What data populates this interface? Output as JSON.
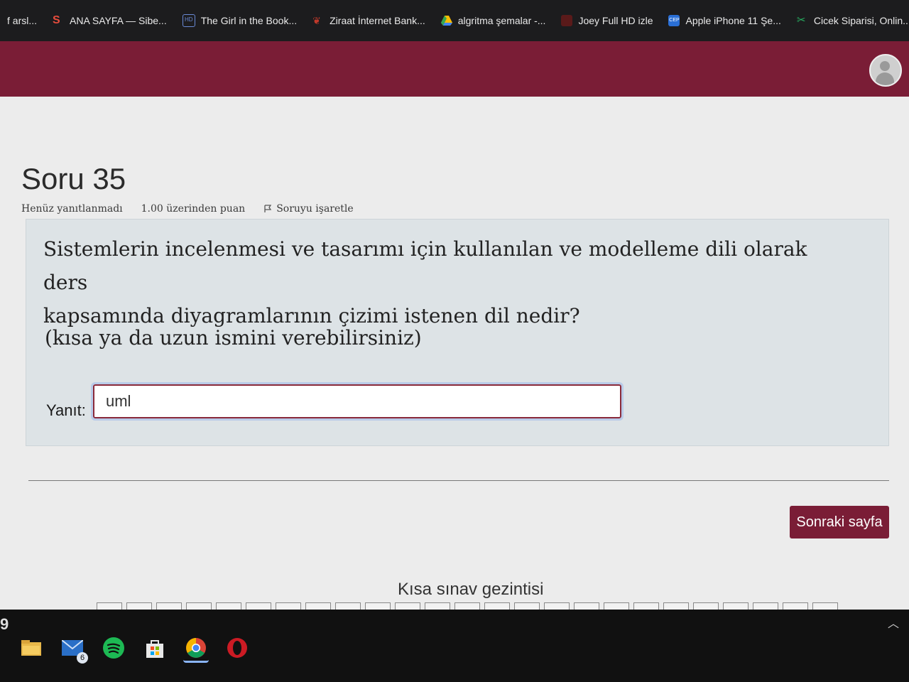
{
  "bookmarks": [
    {
      "label": "f arsl...",
      "icon": "doc-icon",
      "color": "#444"
    },
    {
      "label": "ANA SAYFA — Sibe...",
      "icon": "s-logo-icon",
      "color": "#e74c3c"
    },
    {
      "label": "The Girl in the Book...",
      "icon": "hd-icon",
      "color": "#3b5998"
    },
    {
      "label": "Ziraat İnternet Bank...",
      "icon": "wheat-icon",
      "color": "#c0392b"
    },
    {
      "label": "algritma şemalar -...",
      "icon": "drive-icon",
      "color": "#34a853"
    },
    {
      "label": "Joey Full HD izle",
      "icon": "cup-icon",
      "color": "#8e2a2a"
    },
    {
      "label": "Apple iPhone 11 Şe...",
      "icon": "cep-icon",
      "color": "#2a6fd6"
    },
    {
      "label": "Cicek Siparisi, Onlin...",
      "icon": "flower-icon",
      "color": "#27ae60"
    }
  ],
  "quiz": {
    "title": "Soru 35",
    "status": "Henüz yanıtlanmadı",
    "points": "1.00 üzerinden puan",
    "flag_label": "Soruyu işaretle",
    "question_line1": "Sistemlerin incelenmesi ve tasarımı için kullanılan ve modelleme dili olarak ders",
    "question_line2": "kapsamında diyagramlarının çizimi istenen dil nedir?",
    "hint": "(kısa ya da uzun ismini verebilirsiniz)",
    "answer_label": "Yanıt:",
    "answer_value": "uml",
    "next_button": "Sonraki sayfa",
    "nav_title": "Kısa sınav gezintisi"
  },
  "taskbar": {
    "left_number": "9",
    "mail_badge": "6",
    "icons": [
      "folder-icon",
      "mail-icon",
      "spotify-icon",
      "store-icon",
      "chrome-icon",
      "opera-icon"
    ]
  }
}
